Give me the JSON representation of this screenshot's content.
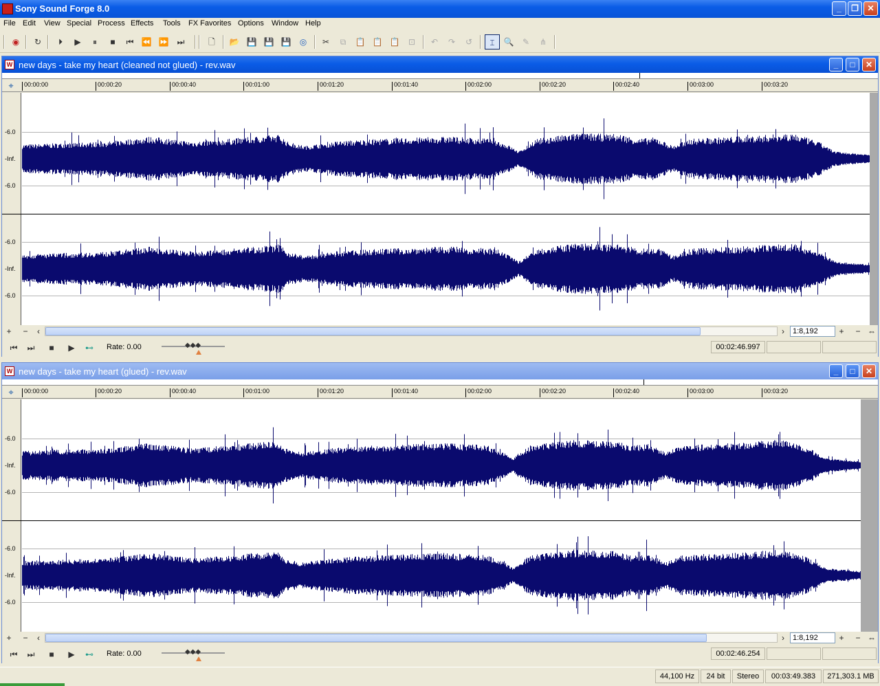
{
  "app": {
    "title": "Sony Sound Forge 8.0"
  },
  "menu": [
    "File",
    "Edit",
    "View",
    "Special",
    "Process",
    "Effects",
    "Tools",
    "FX Favorites",
    "Options",
    "Window",
    "Help"
  ],
  "toolbar_icons": [
    "record-icon",
    "loop-icon",
    "play-all-icon",
    "play-icon",
    "pause-icon",
    "stop-icon",
    "go-to-start-icon",
    "rewind-icon",
    "fast-forward-icon",
    "go-to-end-icon",
    "new-icon",
    "open-icon",
    "save-icon",
    "save-as-icon",
    "render-icon",
    "publish-icon",
    "cut-icon",
    "copy-icon",
    "paste-icon",
    "mix-icon",
    "paste-new-icon",
    "trim-icon",
    "undo-icon",
    "redo-icon",
    "repeat-icon",
    "edit-tool-icon",
    "magnify-tool-icon",
    "pencil-tool-icon",
    "envelope-tool-icon"
  ],
  "windows": [
    {
      "title": "new days - take my heart (cleaned not glued) - rev.wav",
      "state": "active",
      "zoom": "1:8,192",
      "rate": "Rate: 0.00",
      "cursor": "00:02:46.997",
      "seed": 7,
      "end_fraction": 1.0
    },
    {
      "title": "new days - take my heart (glued) - rev.wav",
      "state": "inactive",
      "zoom": "1:8,192",
      "rate": "Rate: 0.00",
      "cursor": "00:02:46.254",
      "seed": 13,
      "end_fraction": 0.989
    }
  ],
  "ruler_ticks": [
    "00:00:00",
    "00:00:20",
    "00:00:40",
    "00:01:00",
    "00:01:20",
    "00:01:40",
    "00:02:00",
    "00:02:20",
    "00:02:40",
    "00:03:00",
    "00:03:20"
  ],
  "db_labels": {
    "top": "-6.0",
    "center": "-Inf.",
    "bottom": "-6.0"
  },
  "status": {
    "sample_rate": "44,100 Hz",
    "bit_depth": "24 bit",
    "channels": "Stereo",
    "length": "00:03:49.383",
    "free_space": "271,303.1 MB"
  },
  "colors": {
    "waveform": "#0a0a6e",
    "titlebar_active": "#0a5ce6",
    "titlebar_inactive": "#7a9fe8"
  }
}
